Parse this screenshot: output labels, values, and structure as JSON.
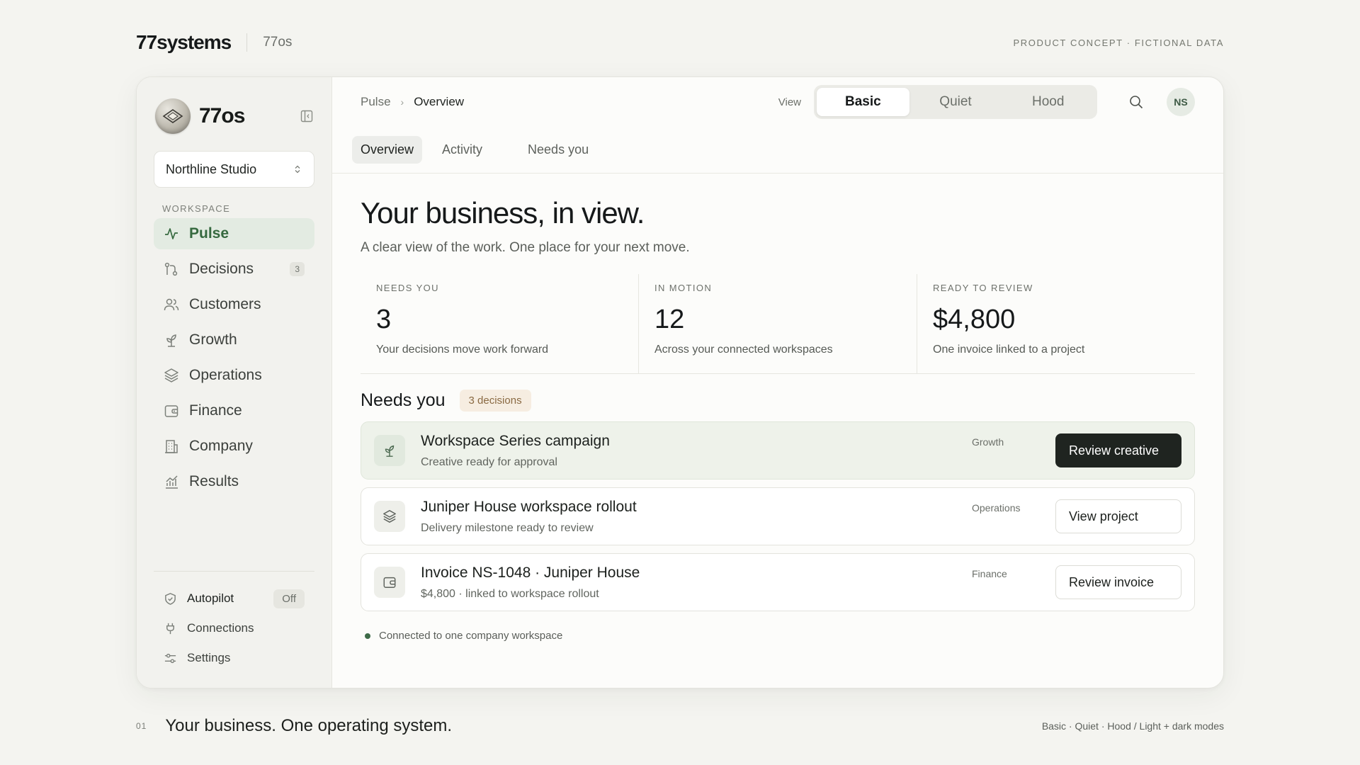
{
  "page": {
    "brand": "77systems",
    "brand_sub": "77os",
    "concept_note": "PRODUCT CONCEPT · FICTIONAL DATA",
    "slide_number": "01",
    "tagline": "Your business. One operating system.",
    "modes": "Basic · Quiet · Hood / Light + dark modes"
  },
  "sidebar": {
    "app_name": "77os",
    "org": "Northline Studio",
    "section_label": "WORKSPACE",
    "items": [
      {
        "label": "Pulse",
        "icon": "pulse-icon",
        "active": true
      },
      {
        "label": "Decisions",
        "icon": "decisions-icon",
        "badge": "3"
      },
      {
        "label": "Customers",
        "icon": "customers-icon"
      },
      {
        "label": "Growth",
        "icon": "sprout-icon"
      },
      {
        "label": "Operations",
        "icon": "layers-icon"
      },
      {
        "label": "Finance",
        "icon": "wallet-icon"
      },
      {
        "label": "Company",
        "icon": "building-icon"
      },
      {
        "label": "Results",
        "icon": "chart-icon"
      }
    ],
    "autopilot": {
      "label": "Autopilot",
      "state": "Off"
    },
    "connections": "Connections",
    "settings": "Settings"
  },
  "topbar": {
    "breadcrumb_root": "Pulse",
    "breadcrumb_current": "Overview",
    "view_label": "View",
    "view_options": [
      "Basic",
      "Quiet",
      "Hood"
    ],
    "view_selected": "Basic",
    "avatar_initials": "NS"
  },
  "tabs": [
    "Overview",
    "Activity",
    "Needs you"
  ],
  "hero": {
    "title": "Your business, in view.",
    "subtitle": "A clear view of the work. One place for your next move."
  },
  "stats": [
    {
      "label": "NEEDS YOU",
      "value": "3",
      "desc": "Your decisions move work forward"
    },
    {
      "label": "IN MOTION",
      "value": "12",
      "desc": "Across your connected workspaces"
    },
    {
      "label": "READY TO REVIEW",
      "value": "$4,800",
      "desc": "One invoice linked to a project"
    }
  ],
  "needs": {
    "title": "Needs you",
    "count_label": "3 decisions",
    "items": [
      {
        "title": "Workspace Series campaign",
        "sub": "Creative ready for approval",
        "tag": "Growth",
        "action": "Review creative",
        "icon": "sprout-icon"
      },
      {
        "title": "Juniper House workspace rollout",
        "sub": "Delivery milestone ready to review",
        "tag": "Operations",
        "action": "View project",
        "icon": "layers-icon"
      },
      {
        "title": "Invoice NS-1048 · Juniper House",
        "sub": "$4,800 · linked to workspace rollout",
        "tag": "Finance",
        "action": "Review invoice",
        "icon": "wallet-icon"
      }
    ]
  },
  "status": "Connected to one company workspace",
  "colors": {
    "accent": "#36693f",
    "primary_button": "#1f2420",
    "pill_bg": "#f6ede1"
  }
}
